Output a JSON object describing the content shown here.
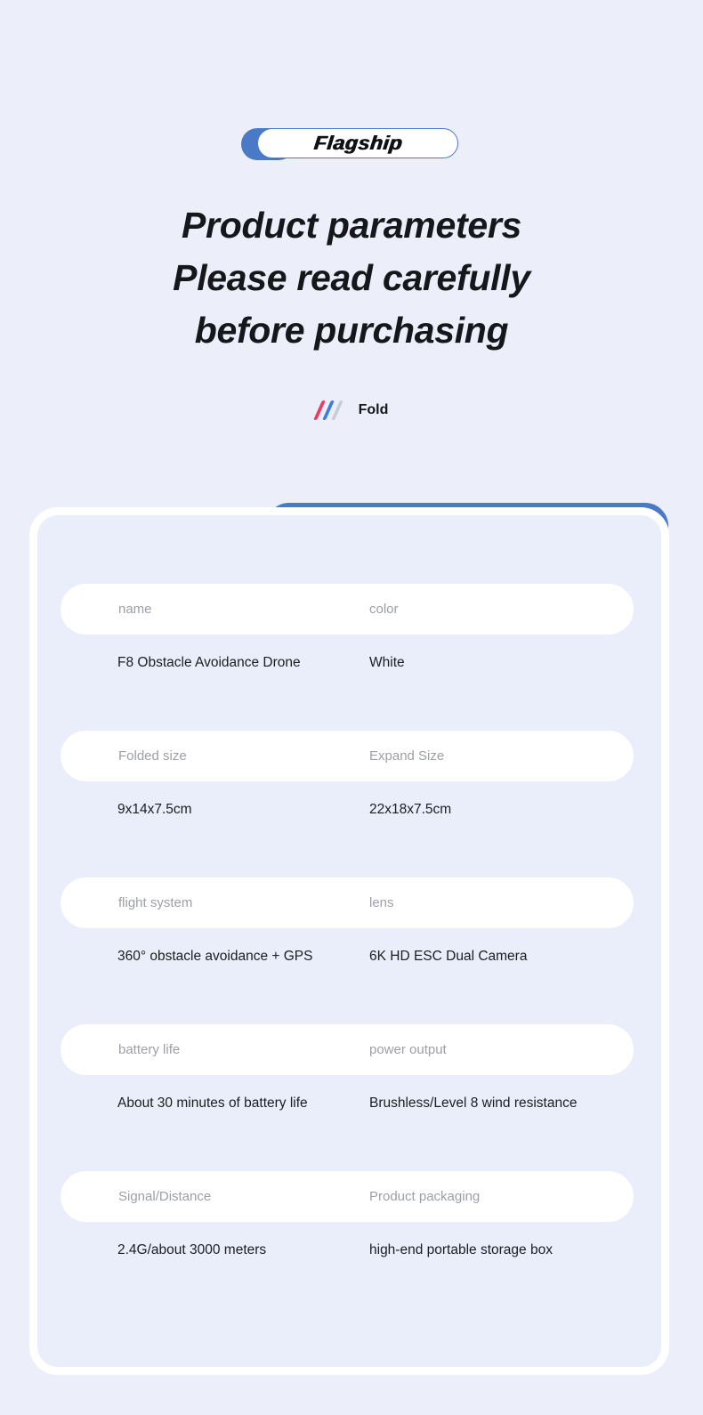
{
  "badge": {
    "text": "Flagship",
    "accent_color": "#4a7ac7"
  },
  "headline": {
    "line1": "Product parameters",
    "line2": "Please read carefully",
    "line3": "before purchasing"
  },
  "fold": {
    "label": "Fold",
    "icon": "triple-slash-icon",
    "slash_colors": [
      "#ec3b63",
      "#3d7ee0",
      "#c9ccd4"
    ]
  },
  "page": {
    "background_color": "#eceff9",
    "card_background_color": "#eaeefb",
    "pill_color": "#ffffff",
    "label_color": "#9d9fa8",
    "value_color": "#1c1d21"
  },
  "parameters": {
    "rows": [
      {
        "label_left": "name",
        "label_right": "color",
        "value_left": "F8 Obstacle Avoidance Drone",
        "value_right": "White"
      },
      {
        "label_left": "Folded size",
        "label_right": "Expand Size",
        "value_left": "9x14x7.5cm",
        "value_right": "22x18x7.5cm"
      },
      {
        "label_left": "flight system",
        "label_right": "lens",
        "value_left": "360° obstacle avoidance + GPS",
        "value_right": "6K HD ESC Dual Camera"
      },
      {
        "label_left": "battery life",
        "label_right": "power output",
        "value_left": "About 30 minutes of battery life",
        "value_right": "Brushless/Level 8 wind resistance"
      },
      {
        "label_left": "Signal/Distance",
        "label_right": "Product packaging",
        "value_left": "2.4G/about 3000 meters",
        "value_right": "high-end portable storage box"
      }
    ]
  }
}
